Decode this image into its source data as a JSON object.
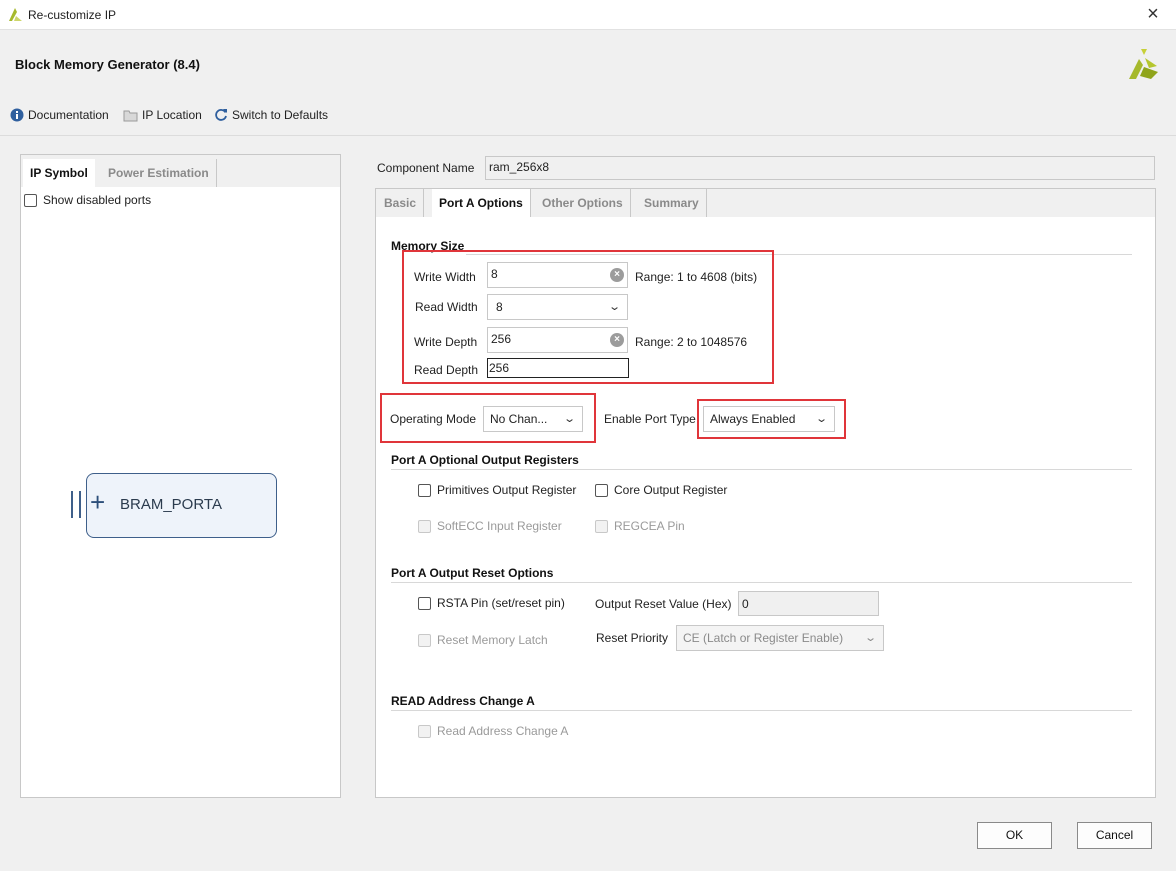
{
  "window": {
    "title": "Re-customize IP"
  },
  "header": {
    "ip_title": "Block Memory Generator (8.4)"
  },
  "toolbar": {
    "documentation": "Documentation",
    "ip_location": "IP Location",
    "switch_defaults": "Switch to Defaults"
  },
  "left": {
    "tabs": [
      "IP Symbol",
      "Power Estimation"
    ],
    "show_disabled_ports": "Show disabled ports",
    "symbol_label": "BRAM_PORTA"
  },
  "component": {
    "label": "Component Name",
    "value": "ram_256x8"
  },
  "right_tabs": [
    "Basic",
    "Port A Options",
    "Other Options",
    "Summary"
  ],
  "memory_size": {
    "title": "Memory Size",
    "write_width_label": "Write Width",
    "write_width": "8",
    "write_width_range": "Range: 1 to 4608 (bits)",
    "read_width_label": "Read Width",
    "read_width": "8",
    "write_depth_label": "Write Depth",
    "write_depth": "256",
    "write_depth_range": "Range: 2 to 1048576",
    "read_depth_label": "Read Depth",
    "read_depth": "256"
  },
  "operating_mode": {
    "label": "Operating Mode",
    "value": "No Chan..."
  },
  "enable_port_type": {
    "label": "Enable Port Type",
    "value": "Always Enabled"
  },
  "optional_regs": {
    "title": "Port A Optional Output Registers",
    "primitives": "Primitives Output Register",
    "core": "Core Output Register",
    "softecc": "SoftECC Input Register",
    "regcea": "REGCEA Pin"
  },
  "reset_options": {
    "title": "Port A Output Reset Options",
    "rsta": "RSTA Pin (set/reset pin)",
    "output_reset_label": "Output Reset Value (Hex)",
    "output_reset_value": "0",
    "reset_latch": "Reset Memory Latch",
    "priority_label": "Reset Priority",
    "priority_value": "CE (Latch or Register Enable)"
  },
  "read_addr": {
    "title": "READ Address Change A",
    "checkbox": "Read Address Change A"
  },
  "buttons": {
    "ok": "OK",
    "cancel": "Cancel"
  },
  "colors": {
    "highlight": "#e0353a",
    "brand": "#9cb21f"
  }
}
